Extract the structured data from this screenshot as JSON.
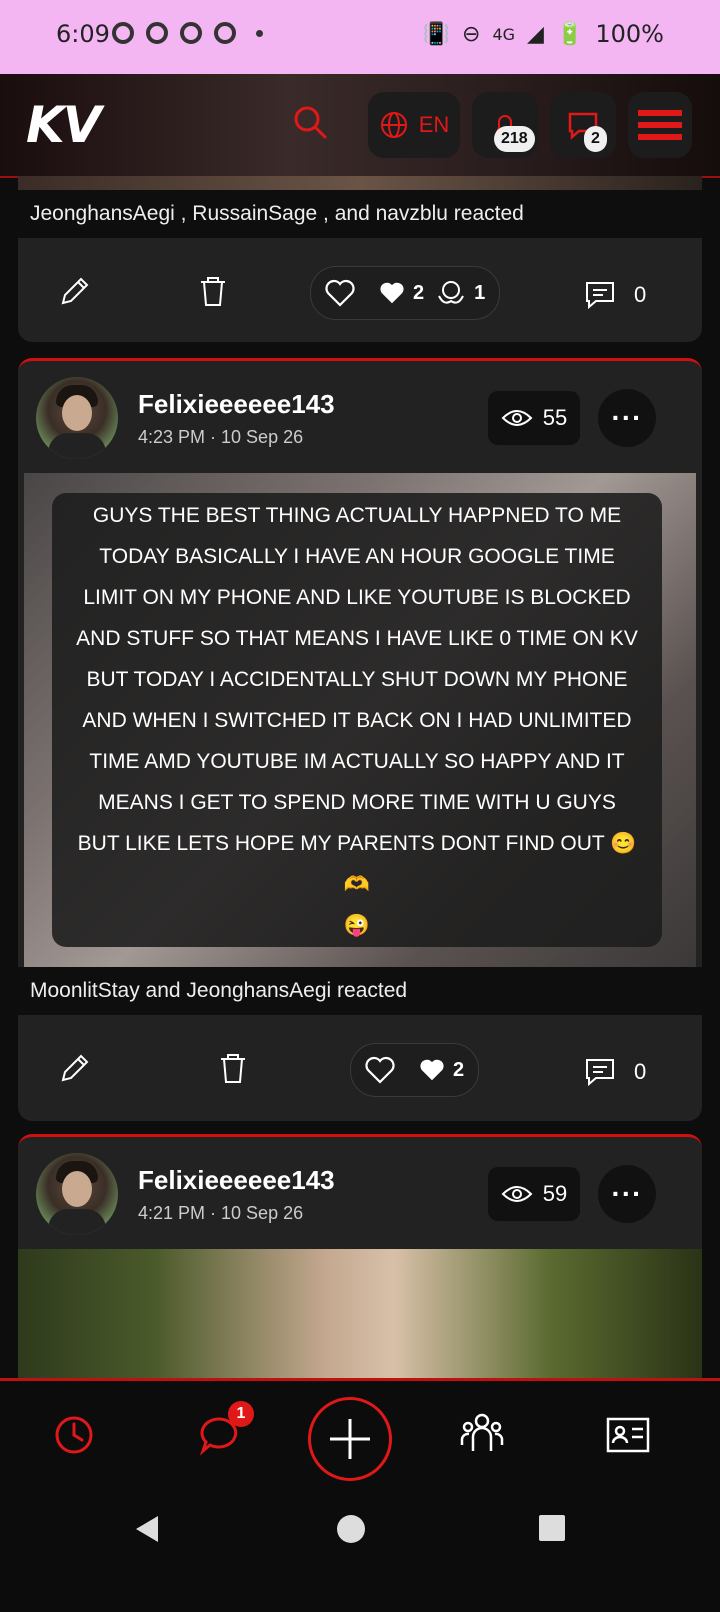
{
  "status_bar": {
    "time": "6:09",
    "network": "4G",
    "battery": "100%"
  },
  "header": {
    "logo": "KV",
    "language": "EN",
    "notifications_count": "218",
    "messages_count": "2"
  },
  "post1": {
    "reacted_text": "JeonghansAegi , RussainSage , and navzblu reacted",
    "likes": "2",
    "hugs": "1",
    "comments": "0"
  },
  "post2": {
    "username": "Felixieeeeee143",
    "timestamp": "4:23 PM · 10 Sep 26",
    "views": "55",
    "body": "GUYS THE BEST THING ACTUALLY HAPPNED TO ME TODAY BASICALLY I HAVE AN HOUR GOOGLE TIME LIMIT ON MY PHONE AND LIKE YOUTUBE IS BLOCKED AND STUFF SO THAT MEANS I HAVE LIKE 0 TIME ON KV\nBUT TODAY I ACCIDENTALLY SHUT DOWN MY PHONE AND WHEN I SWITCHED IT BACK ON I HAD UNLIMITED TIME AMD YOUTUBE IM ACTUALLY SO HAPPY AND IT MEANS I GET TO SPEND MORE TIME WITH U GUYS\nBUT LIKE LETS HOPE MY PARENTS DONT FIND OUT 😊🫶\n😜",
    "reacted_text": "MoonlitStay and JeonghansAegi reacted",
    "likes": "2",
    "comments": "0"
  },
  "post3": {
    "username": "Felixieeeeee143",
    "timestamp": "4:21 PM · 10 Sep 26",
    "views": "59"
  },
  "bottom_nav": {
    "chat_badge": "1"
  },
  "colors": {
    "accent": "#e01818",
    "card": "#222222",
    "background": "#0d0d0d"
  }
}
